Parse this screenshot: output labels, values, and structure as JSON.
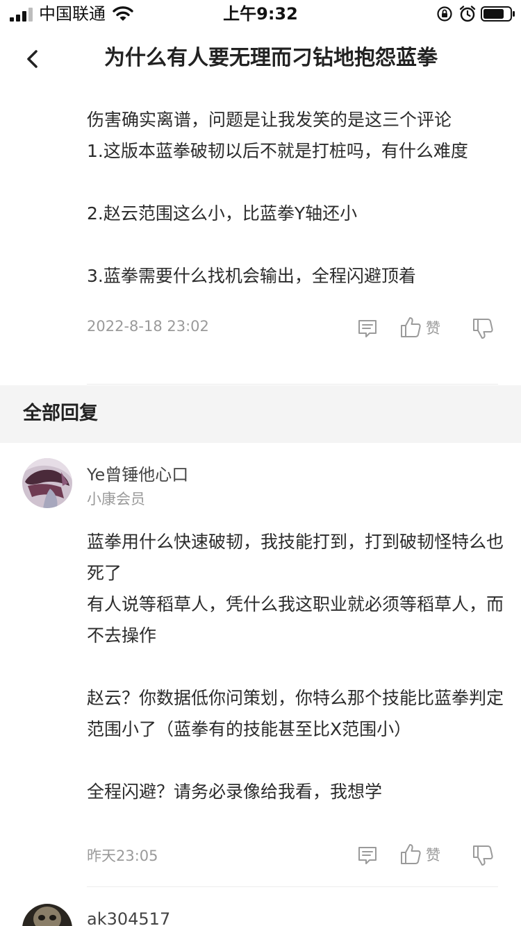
{
  "status_bar": {
    "carrier": "中国联通",
    "time": "上午9:32"
  },
  "nav": {
    "title": "为什么有人要无理而刁钻地抱怨蓝拳"
  },
  "post": {
    "text": "伤害确实离谱，问题是让我发笑的是这三个评论\n1.这版本蓝拳破韧以后不就是打桩吗，有什么难度\n\n2.赵云范围这么小，比蓝拳Y轴还小\n\n3.蓝拳需要什么找机会输出，全程闪避顶着",
    "time": "2022-8-18 23:02",
    "like_label": "赞"
  },
  "section": {
    "title": "全部回复"
  },
  "replies": [
    {
      "name": "Ye曾锤他心口",
      "level": "小康会员",
      "text": "蓝拳用什么快速破韧，我技能打到，打到破韧怪特么也死了\n有人说等稻草人，凭什么我这职业就必须等稻草人，而不去操作\n\n赵云？你数据低你问策划，你特么那个技能比蓝拳判定范围小了（蓝拳有的技能甚至比X范围小）\n\n全程闪避？请务必录像给我看，我想学",
      "time": "昨天23:05",
      "like_label": "赞"
    },
    {
      "name": "ak304517"
    }
  ],
  "colors": {
    "text": "#2b2b2b",
    "muted": "#9a9a9a",
    "section_bg": "#f4f4f4",
    "divider": "#ececec"
  },
  "icons": [
    "signal-icon",
    "wifi-icon",
    "lock-rotation-icon",
    "alarm-icon",
    "battery-icon",
    "back-arrow-icon",
    "comment-icon",
    "thumbs-up-icon",
    "thumbs-down-icon"
  ]
}
